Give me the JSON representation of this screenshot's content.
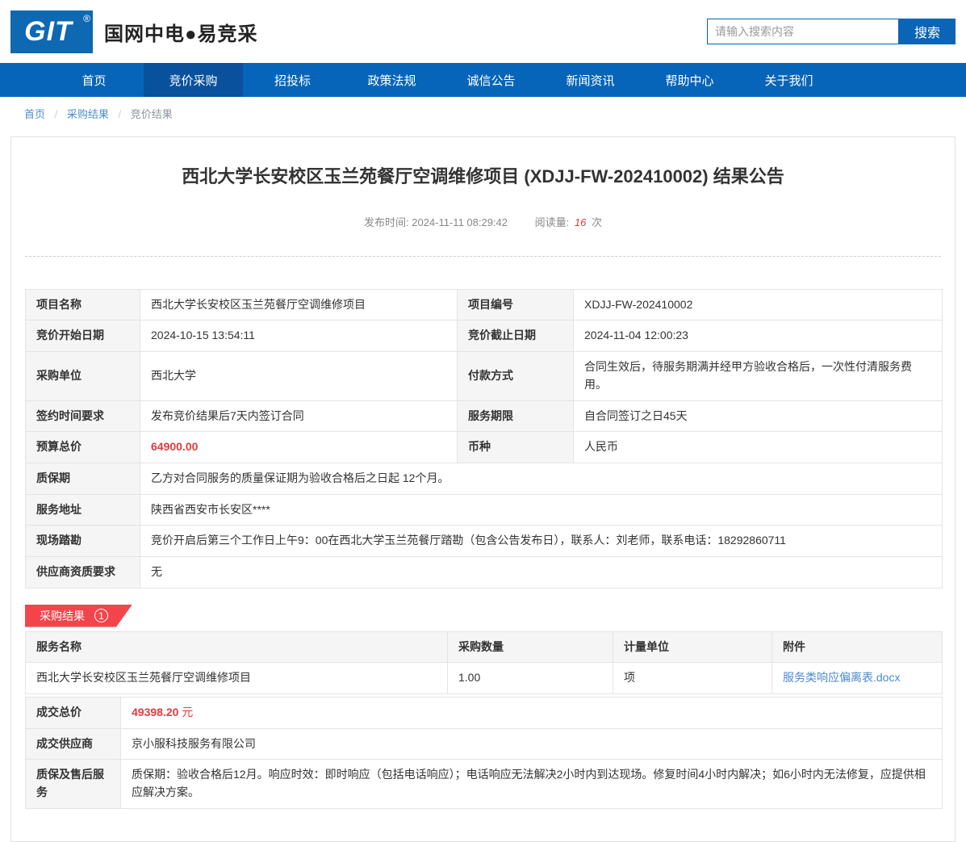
{
  "brand": {
    "logo_text": "GIT",
    "logo_reg": "®",
    "site_name": "国网中电●易竞采"
  },
  "search": {
    "placeholder": "请输入搜索内容",
    "button_label": "搜索"
  },
  "nav": {
    "items": [
      {
        "label": "首页",
        "active": false
      },
      {
        "label": "竞价采购",
        "active": true
      },
      {
        "label": "招投标",
        "active": false
      },
      {
        "label": "政策法规",
        "active": false
      },
      {
        "label": "诚信公告",
        "active": false
      },
      {
        "label": "新闻资讯",
        "active": false
      },
      {
        "label": "帮助中心",
        "active": false
      },
      {
        "label": "关于我们",
        "active": false
      }
    ]
  },
  "breadcrumb": {
    "separator": "/",
    "items": [
      "首页",
      "采购结果",
      "竞价结果"
    ]
  },
  "article": {
    "title": "西北大学长安校区玉兰苑餐厅空调维修项目 (XDJJ-FW-202410002) 结果公告",
    "publish_label": "发布时间:",
    "publish_time": "2024-11-11 08:29:42",
    "views_label": "阅读量:",
    "views_count": "16",
    "views_unit": "次"
  },
  "details": {
    "project_name": {
      "label": "项目名称",
      "value": "西北大学长安校区玉兰苑餐厅空调维修项目"
    },
    "project_no": {
      "label": "项目编号",
      "value": "XDJJ-FW-202410002"
    },
    "start_date": {
      "label": "竞价开始日期",
      "value": "2024-10-15 13:54:11"
    },
    "end_date": {
      "label": "竞价截止日期",
      "value": "2024-11-04 12:00:23"
    },
    "purchaser": {
      "label": "采购单位",
      "value": "西北大学"
    },
    "payment": {
      "label": "付款方式",
      "value": "合同生效后，待服务期满并经甲方验收合格后，一次性付清服务费用。"
    },
    "sign_time": {
      "label": "签约时间要求",
      "value": "发布竞价结果后7天内签订合同"
    },
    "service_period": {
      "label": "服务期限",
      "value": "自合同签订之日45天"
    },
    "budget": {
      "label": "预算总价",
      "value": "64900.00"
    },
    "currency": {
      "label": "币种",
      "value": "人民币"
    },
    "warranty": {
      "label": "质保期",
      "value": "乙方对合同服务的质量保证期为验收合格后之日起 12个月。"
    },
    "address": {
      "label": "服务地址",
      "value": "陕西省西安市长安区****"
    },
    "site_visit": {
      "label": "现场踏勘",
      "value": "竞价开启后第三个工作日上午9：00在西北大学玉兰苑餐厅踏勘（包含公告发布日），联系人：刘老师，联系电话：18292860711"
    },
    "qualification": {
      "label": "供应商资质要求",
      "value": "无"
    }
  },
  "result_section": {
    "badge_label": "采购结果",
    "badge_count": "1",
    "table": {
      "headers": {
        "name": "服务名称",
        "qty": "采购数量",
        "unit": "计量单位",
        "attachment": "附件"
      },
      "row": {
        "name": "西北大学长安校区玉兰苑餐厅空调维修项目",
        "qty": "1.00",
        "unit": "项",
        "attachment": "服务类响应偏离表.docx"
      }
    },
    "summary": {
      "deal_price": {
        "label": "成交总价",
        "value": "49398.20",
        "unit": "元"
      },
      "supplier": {
        "label": "成交供应商",
        "value": "京小服科技服务有限公司"
      },
      "after_sales": {
        "label": "质保及售后服务",
        "value": "质保期：验收合格后12月。响应时效：即时响应（包括电话响应）；电话响应无法解决2小时内到达现场。修复时间4小时内解决；如6小时内无法修复，应提供相应解决方案。"
      }
    }
  },
  "colors": {
    "nav_blue": "#0665b8",
    "nav_active_blue": "#09519c",
    "logo_blue": "#0e68b2",
    "badge_red": "#f2454b",
    "price_red": "#e23a3e",
    "link_blue": "#4a89d4",
    "label_bg": "#f5f5f5",
    "border": "#e4e4e4"
  }
}
